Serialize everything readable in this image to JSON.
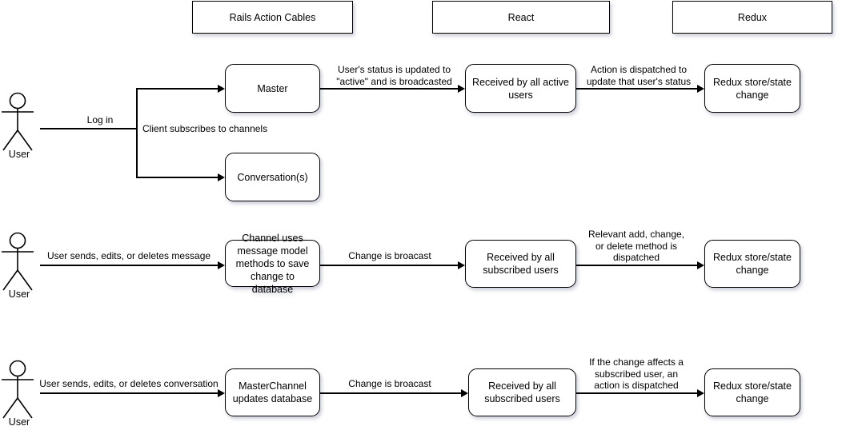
{
  "diagram": {
    "title": "Rails Action Cables / React / Redux data flow",
    "background": "#ffffff",
    "stroke": "#000000"
  },
  "columns": [
    {
      "id": "rails",
      "label": "Rails Action Cables"
    },
    {
      "id": "react",
      "label": "React"
    },
    {
      "id": "redux",
      "label": "Redux"
    }
  ],
  "rows": [
    {
      "id": "login-flow",
      "actor": {
        "label": "User"
      },
      "nodes": [
        {
          "id": "master",
          "label": "Master"
        },
        {
          "id": "conversations",
          "label": "Conversation(s)"
        },
        {
          "id": "received-active",
          "label": "Received by all active\nusers"
        },
        {
          "id": "redux-1",
          "label": "Redux store/state\nchange"
        }
      ],
      "edges": [
        {
          "id": "login",
          "label": "Log in"
        },
        {
          "id": "subscribe",
          "label": "Client subscribes to channels"
        },
        {
          "id": "status-updated",
          "label": "User's status is updated to\n\"active\" and is broadcasted"
        },
        {
          "id": "action-dispatched",
          "label": "Action is dispatched to\nupdate that user's status"
        }
      ]
    },
    {
      "id": "message-flow",
      "actor": {
        "label": "User"
      },
      "nodes": [
        {
          "id": "channel-save",
          "label": "Channel uses\nmessage model\nmethods to save\nchange to database"
        },
        {
          "id": "received-subs-2",
          "label": "Received by all\nsubscribed users"
        },
        {
          "id": "redux-2",
          "label": "Redux store/state\nchange"
        }
      ],
      "edges": [
        {
          "id": "user-message",
          "label": "User sends, edits, or deletes message"
        },
        {
          "id": "broadcast-2",
          "label": "Change is broacast"
        },
        {
          "id": "method-dispatched",
          "label": "Relevant add, change,\nor delete method is\ndispatched"
        }
      ]
    },
    {
      "id": "conversation-flow",
      "actor": {
        "label": "User"
      },
      "nodes": [
        {
          "id": "masterchannel",
          "label": "MasterChannel\nupdates database"
        },
        {
          "id": "received-subs-3",
          "label": "Received by all\nsubscribed users"
        },
        {
          "id": "redux-3",
          "label": "Redux store/state\nchange"
        }
      ],
      "edges": [
        {
          "id": "user-conversation",
          "label": "User sends, edits, or deletes conversation"
        },
        {
          "id": "broadcast-3",
          "label": "Change is broacast"
        },
        {
          "id": "conditional-dispatch",
          "label": "If the change affects a\nsubscribed user, an\naction is dispatched"
        }
      ]
    }
  ]
}
